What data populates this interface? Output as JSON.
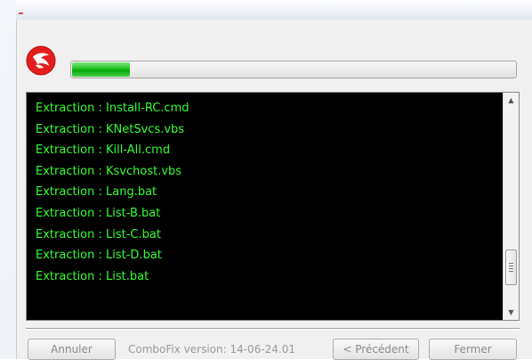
{
  "window": {
    "progress_fraction": 0.13
  },
  "log": {
    "lines": [
      "Extraction : Install-RC.cmd",
      "Extraction : KNetSvcs.vbs",
      "Extraction : Kill-All.cmd",
      "Extraction : Ksvchost.vbs",
      "Extraction : Lang.bat",
      "Extraction : List-B.bat",
      "Extraction : List-C.bat",
      "Extraction : List-D.bat",
      "Extraction : List.bat"
    ]
  },
  "footer": {
    "cancel_label": "Annuler",
    "version_text": "ComboFix version: 14-06-24.01",
    "previous_label": "< Précédent",
    "close_label": "Fermer"
  },
  "colors": {
    "log_text": "#33ff33",
    "log_background": "#000000",
    "progress": "#22c122"
  },
  "icons": {
    "app": "combofix-logo-icon",
    "scroll_up": "arrow-up-icon",
    "scroll_down": "arrow-down-icon"
  }
}
